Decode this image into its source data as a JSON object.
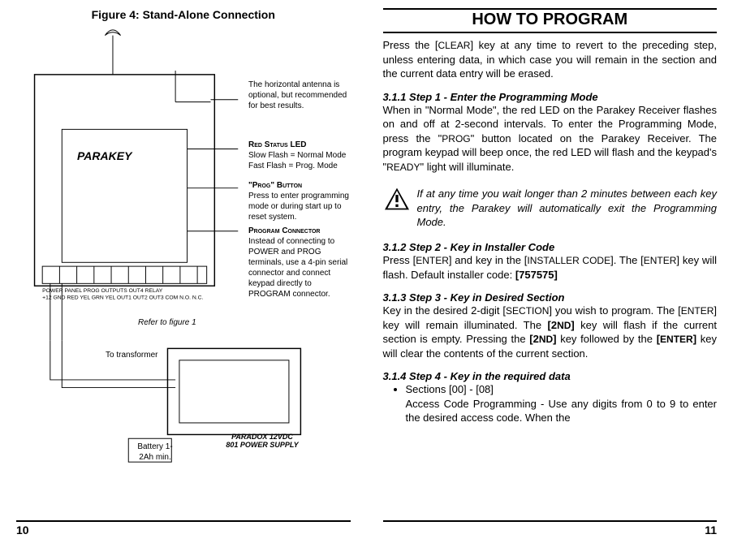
{
  "left": {
    "figure_title": "Figure 4: Stand-Alone Connection",
    "callout_antenna": "The horizontal antenna is optional, but recommended for best results.",
    "callout_led_title": "Red Status LED",
    "callout_led_body": "Slow Flash = Normal Mode\nFast Flash = Prog. Mode",
    "callout_prog_title": "\"Prog\" Button",
    "callout_prog_body": "Press to enter programming mode or during start up to reset system.",
    "callout_conn_title": "Program Connector",
    "callout_conn_body": "Instead of connecting to POWER and PROG terminals, use a 4-pin serial connector and connect keypad directly to PROGRAM connector.",
    "brand_label": "PARAKEY",
    "refer_text": "Refer to figure 1",
    "to_transformer": "To transformer",
    "psu_line1": "PARADOX 12VDC",
    "psu_line2": "801 POWER SUPPLY",
    "battery_text": "Battery\n1-2Ah min.",
    "page_num": "10"
  },
  "right": {
    "header": "HOW TO PROGRAM",
    "intro": "Press the [CLEAR] key at any time to revert to the preceding step, unless entering data, in which case you will remain in the section and the current data entry will be erased.",
    "s1_heading": "3.1.1 Step 1 - Enter the Programming Mode",
    "s1_body": "When in \"Normal Mode\", the red LED on the Parakey Receiver flashes on and off at 2-second intervals. To enter the Programming Mode, press the \"PROG\" button located on the Parakey Receiver. The program keypad will beep once, the red LED will flash and the keypad's \"READY\" light will illuminate.",
    "warning": "If at any time you wait longer than 2 minutes between each key entry, the Parakey will automatically exit the Programming Mode.",
    "s2_heading": "3.1.2 Step 2 - Key in Installer Code",
    "s2_body_pre": "Press [",
    "s2_enter": "ENTER",
    "s2_body_mid": "] and key in the [",
    "s2_installer": "INSTALLER CODE",
    "s2_body_mid2": "]. The [",
    "s2_body_post": "] key will flash. Default installer code: ",
    "s2_code": "[757575]",
    "s3_heading": "3.1.3 Step 3 - Key in Desired Section",
    "s3_body": "Key in the desired 2-digit [SECTION] you wish to program. The [ENTER] key will remain illuminated. The [2ND] key will flash if the current section is empty. Pressing the [2ND] key followed by the [ENTER] key will clear the contents of the current section.",
    "s4_heading": "3.1.4 Step 4 - Key in the required data",
    "s4_bullet": "Sections [00] - [08]",
    "s4_bullet_body": "Access Code Programming - Use any digits from 0 to 9 to enter the desired access code. When the",
    "page_num": "11"
  }
}
